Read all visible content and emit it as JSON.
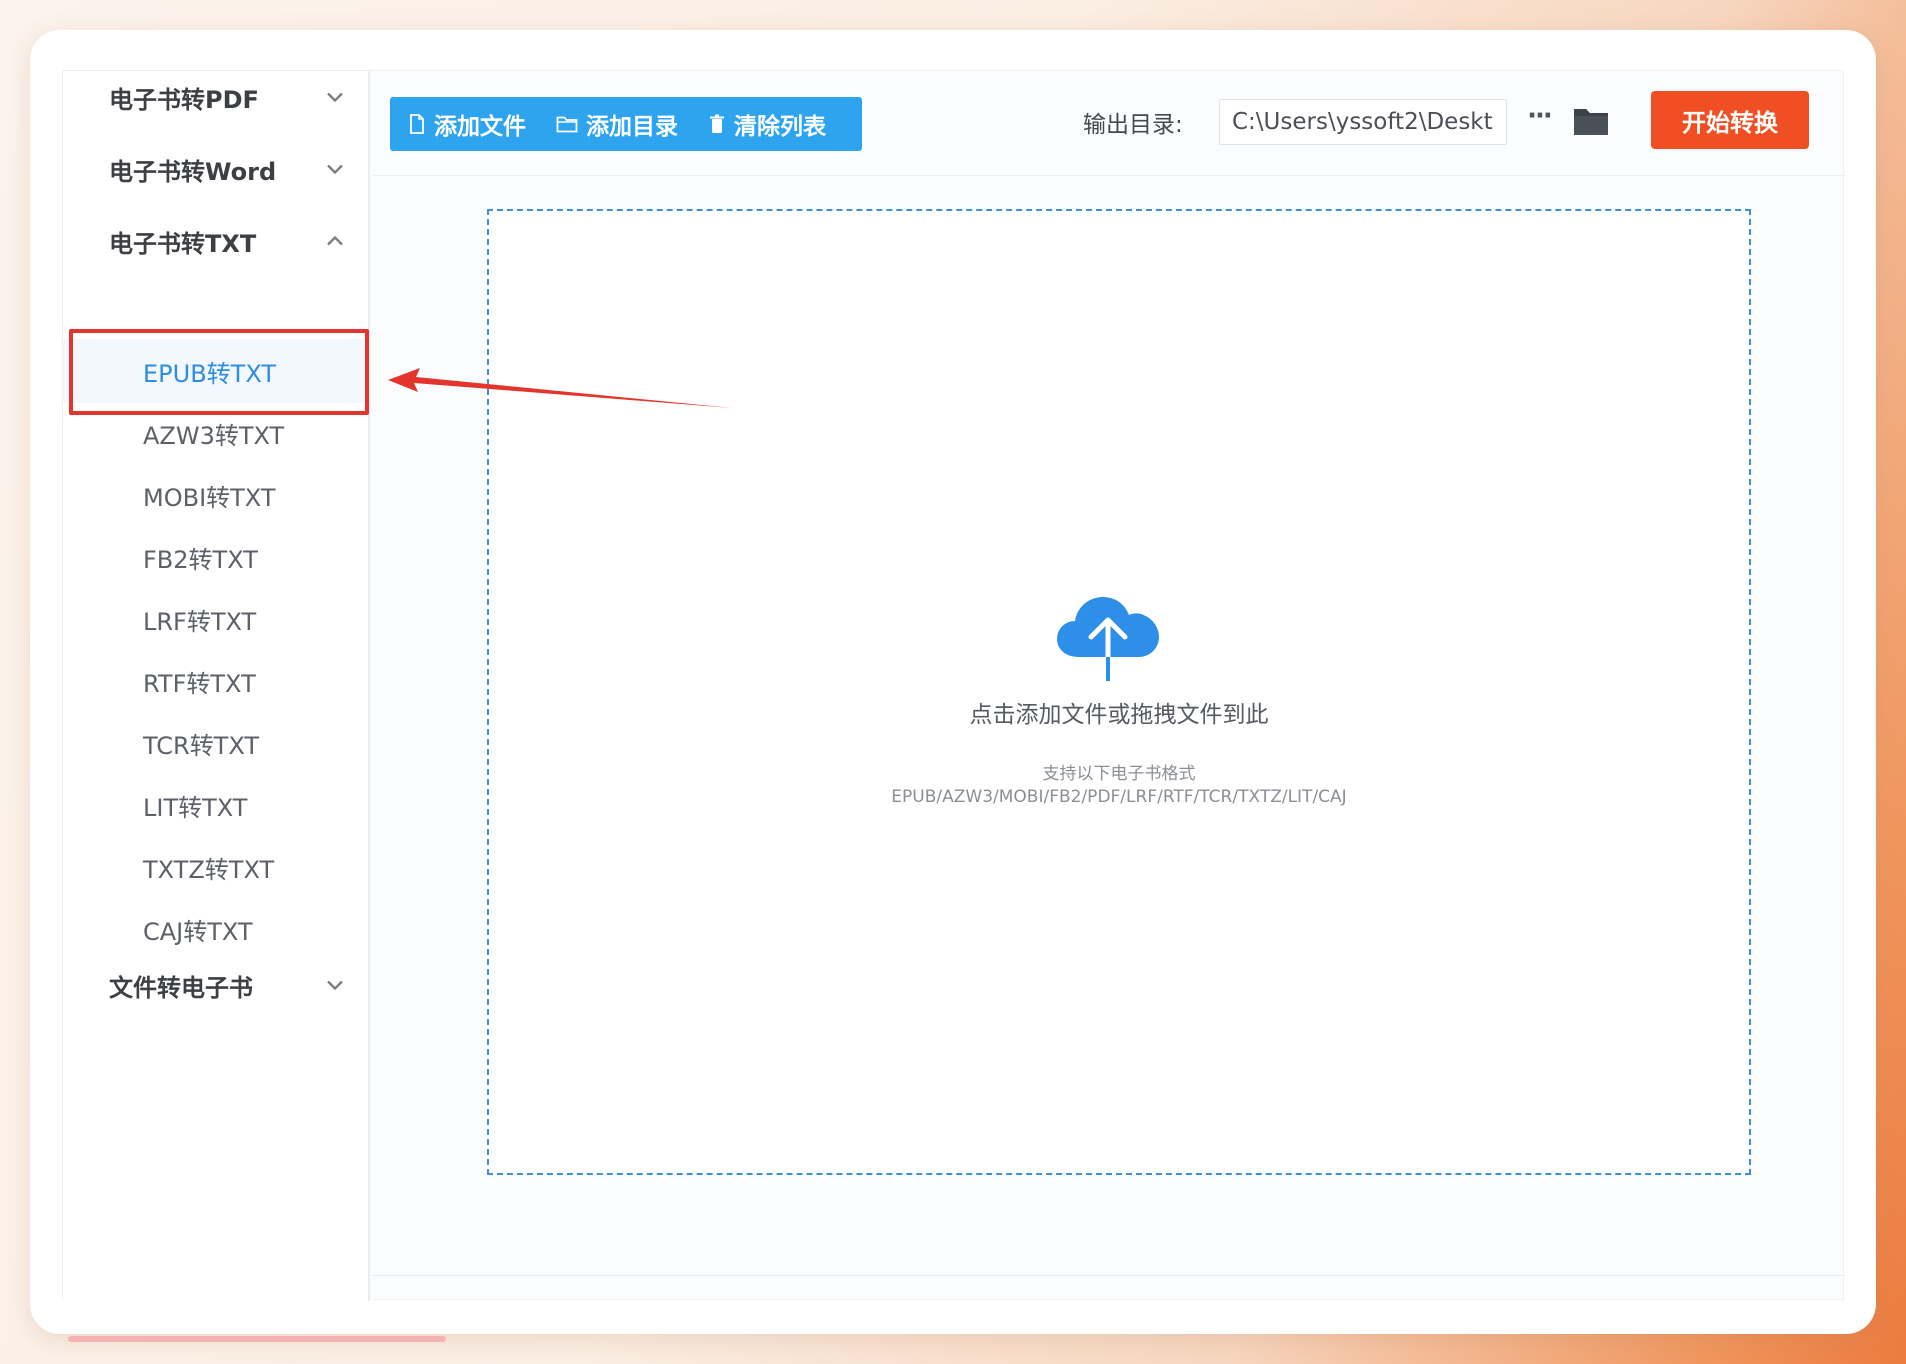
{
  "sidebar": {
    "groups": [
      {
        "label": "电子书转PDF",
        "expanded": false
      },
      {
        "label": "电子书转Word",
        "expanded": false
      },
      {
        "label": "电子书转TXT",
        "expanded": true
      },
      {
        "label": "文件转电子书",
        "expanded": false
      }
    ],
    "txt_items": [
      "EPUB转TXT",
      "AZW3转TXT",
      "MOBI转TXT",
      "FB2转TXT",
      "LRF转TXT",
      "RTF转TXT",
      "TCR转TXT",
      "LIT转TXT",
      "TXTZ转TXT",
      "CAJ转TXT"
    ],
    "active_item": "EPUB转TXT"
  },
  "toolbar": {
    "add_file": "添加文件",
    "add_dir": "添加目录",
    "clear_list": "清除列表",
    "output_label": "输出目录:",
    "output_path": "C:\\Users\\yssoft2\\Deskt",
    "more": "···",
    "start": "开始转换"
  },
  "drop_zone": {
    "title": "点击添加文件或拖拽文件到此",
    "sub": "支持以下电子书格式",
    "formats": "EPUB/AZW3/MOBI/FB2/PDF/LRF/RTF/TCR/TXTZ/LIT/CAJ"
  },
  "colors": {
    "accent_blue": "#2ea4ee",
    "start_button": "#f04e23",
    "active_text": "#2d8ce3",
    "annotation_red": "#e3352b"
  },
  "icons": {
    "add_file": "file-icon",
    "add_dir": "folder-outline-icon",
    "clear_list": "trash-icon",
    "browse": "folder-icon",
    "upload": "cloud-upload-icon"
  }
}
